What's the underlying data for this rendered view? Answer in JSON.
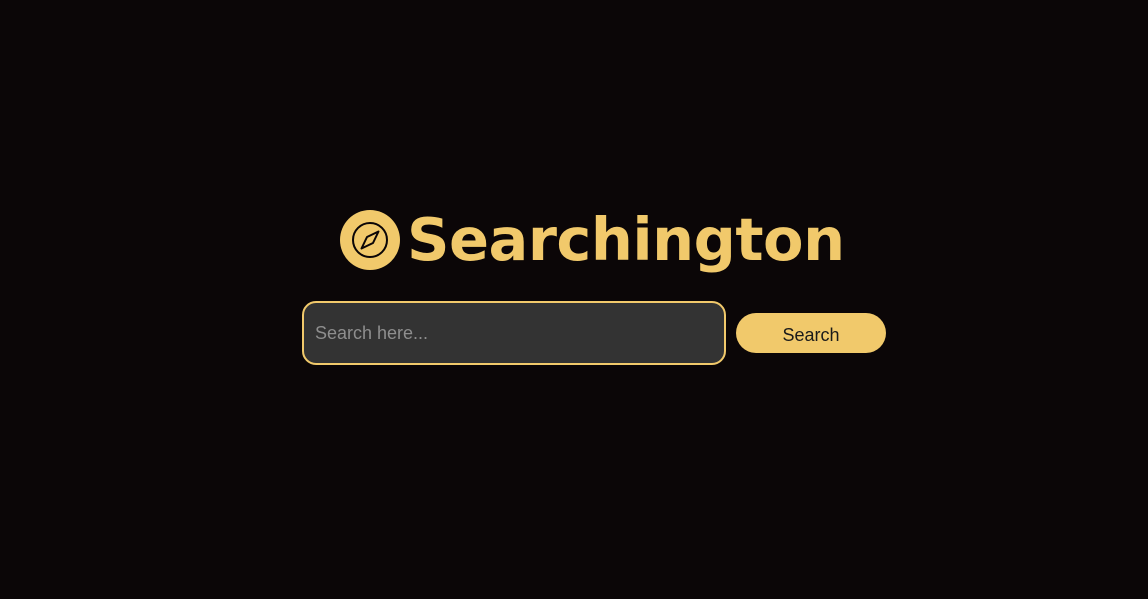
{
  "brand": {
    "title": "Searchington",
    "logo_icon": "compass-icon"
  },
  "search": {
    "placeholder": "Search here...",
    "value": "",
    "button_label": "Search"
  },
  "colors": {
    "background": "#0b0607",
    "accent": "#f1c96b",
    "input_background": "#333333",
    "placeholder": "#8e8e8e",
    "button_text": "#1a1a1a"
  }
}
